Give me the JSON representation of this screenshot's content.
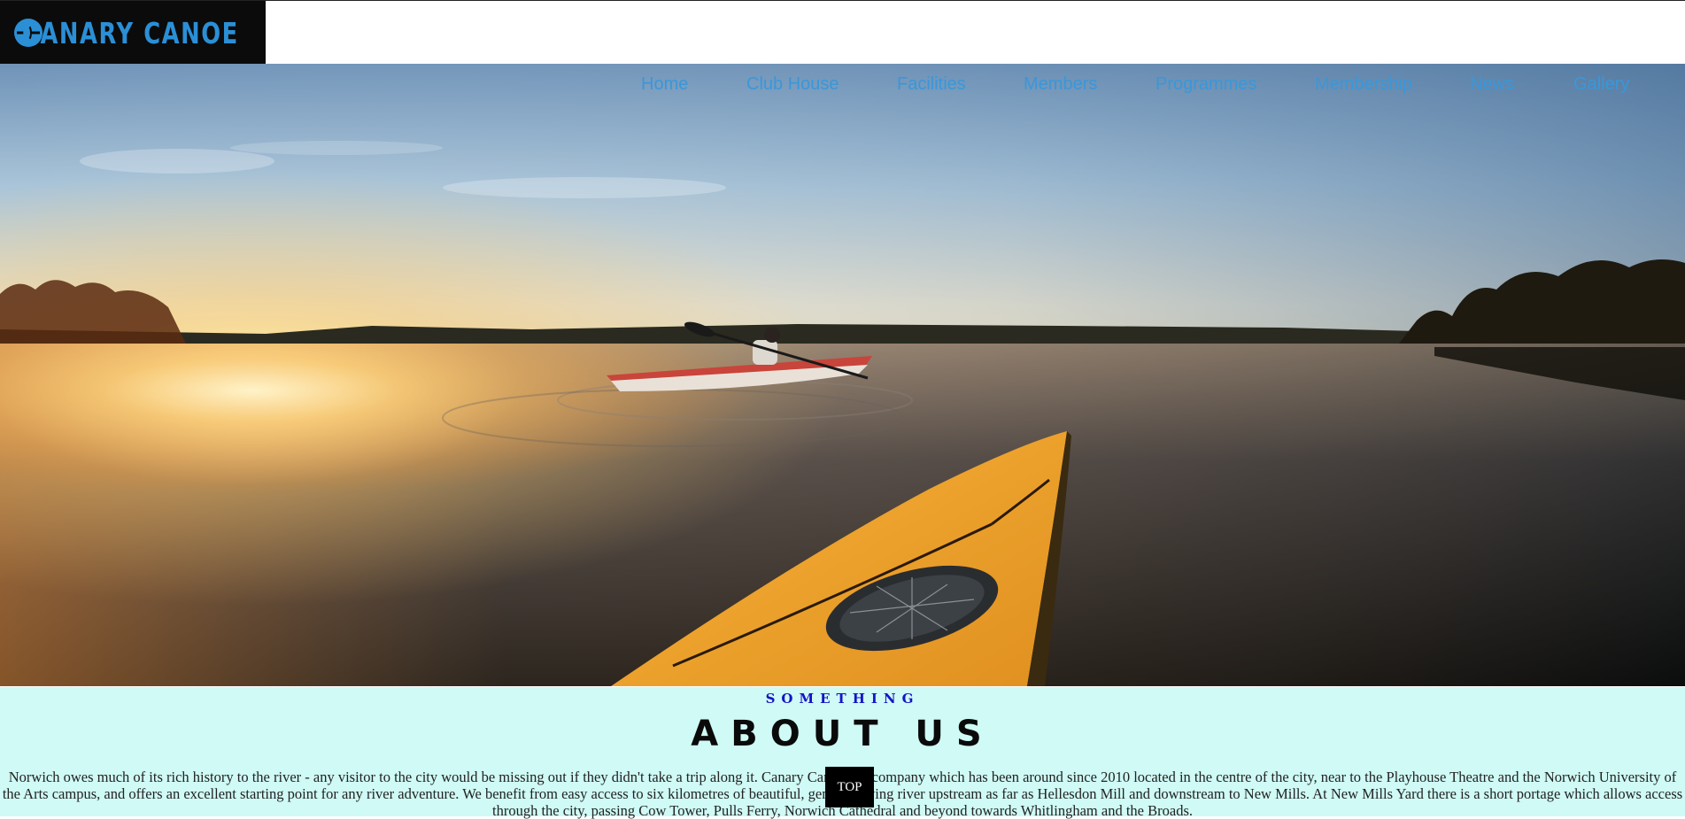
{
  "brand": {
    "logo_text": "CANARY CANOE",
    "accent_color": "#2b8fd6"
  },
  "nav": {
    "items": [
      {
        "label": "Home"
      },
      {
        "label": "Club House"
      },
      {
        "label": "Facilities"
      },
      {
        "label": "Members"
      },
      {
        "label": "Programmes"
      },
      {
        "label": "Membership"
      },
      {
        "label": "News"
      },
      {
        "label": "Gallery"
      }
    ],
    "color": "#3a97d9"
  },
  "hero": {
    "image": "kayak-sunset-lake-photo"
  },
  "about": {
    "eyebrow": "SOMETHING",
    "title": "ABOUT US",
    "body": "Norwich owes much of its rich history to the river - any visitor to the city would be missing out if they didn't take a trip along it. Canary Canoe is a company which has been around since 2010 located in the centre of the city, near to the Playhouse Theatre and the Norwich University of the Arts campus, and offers an excellent starting point for any river adventure. We benefit from easy access to six kilometres of beautiful, gently flowing river upstream as far as Hellesdon Mill and downstream to New Mills. At New Mills Yard there is a short portage which allows access through the city, passing Cow Tower, Pulls Ferry, Norwich Cathedral and beyond towards Whitlingham and the Broads.",
    "background": "#cffaf5"
  },
  "back_to_top": {
    "label": "TOP"
  }
}
